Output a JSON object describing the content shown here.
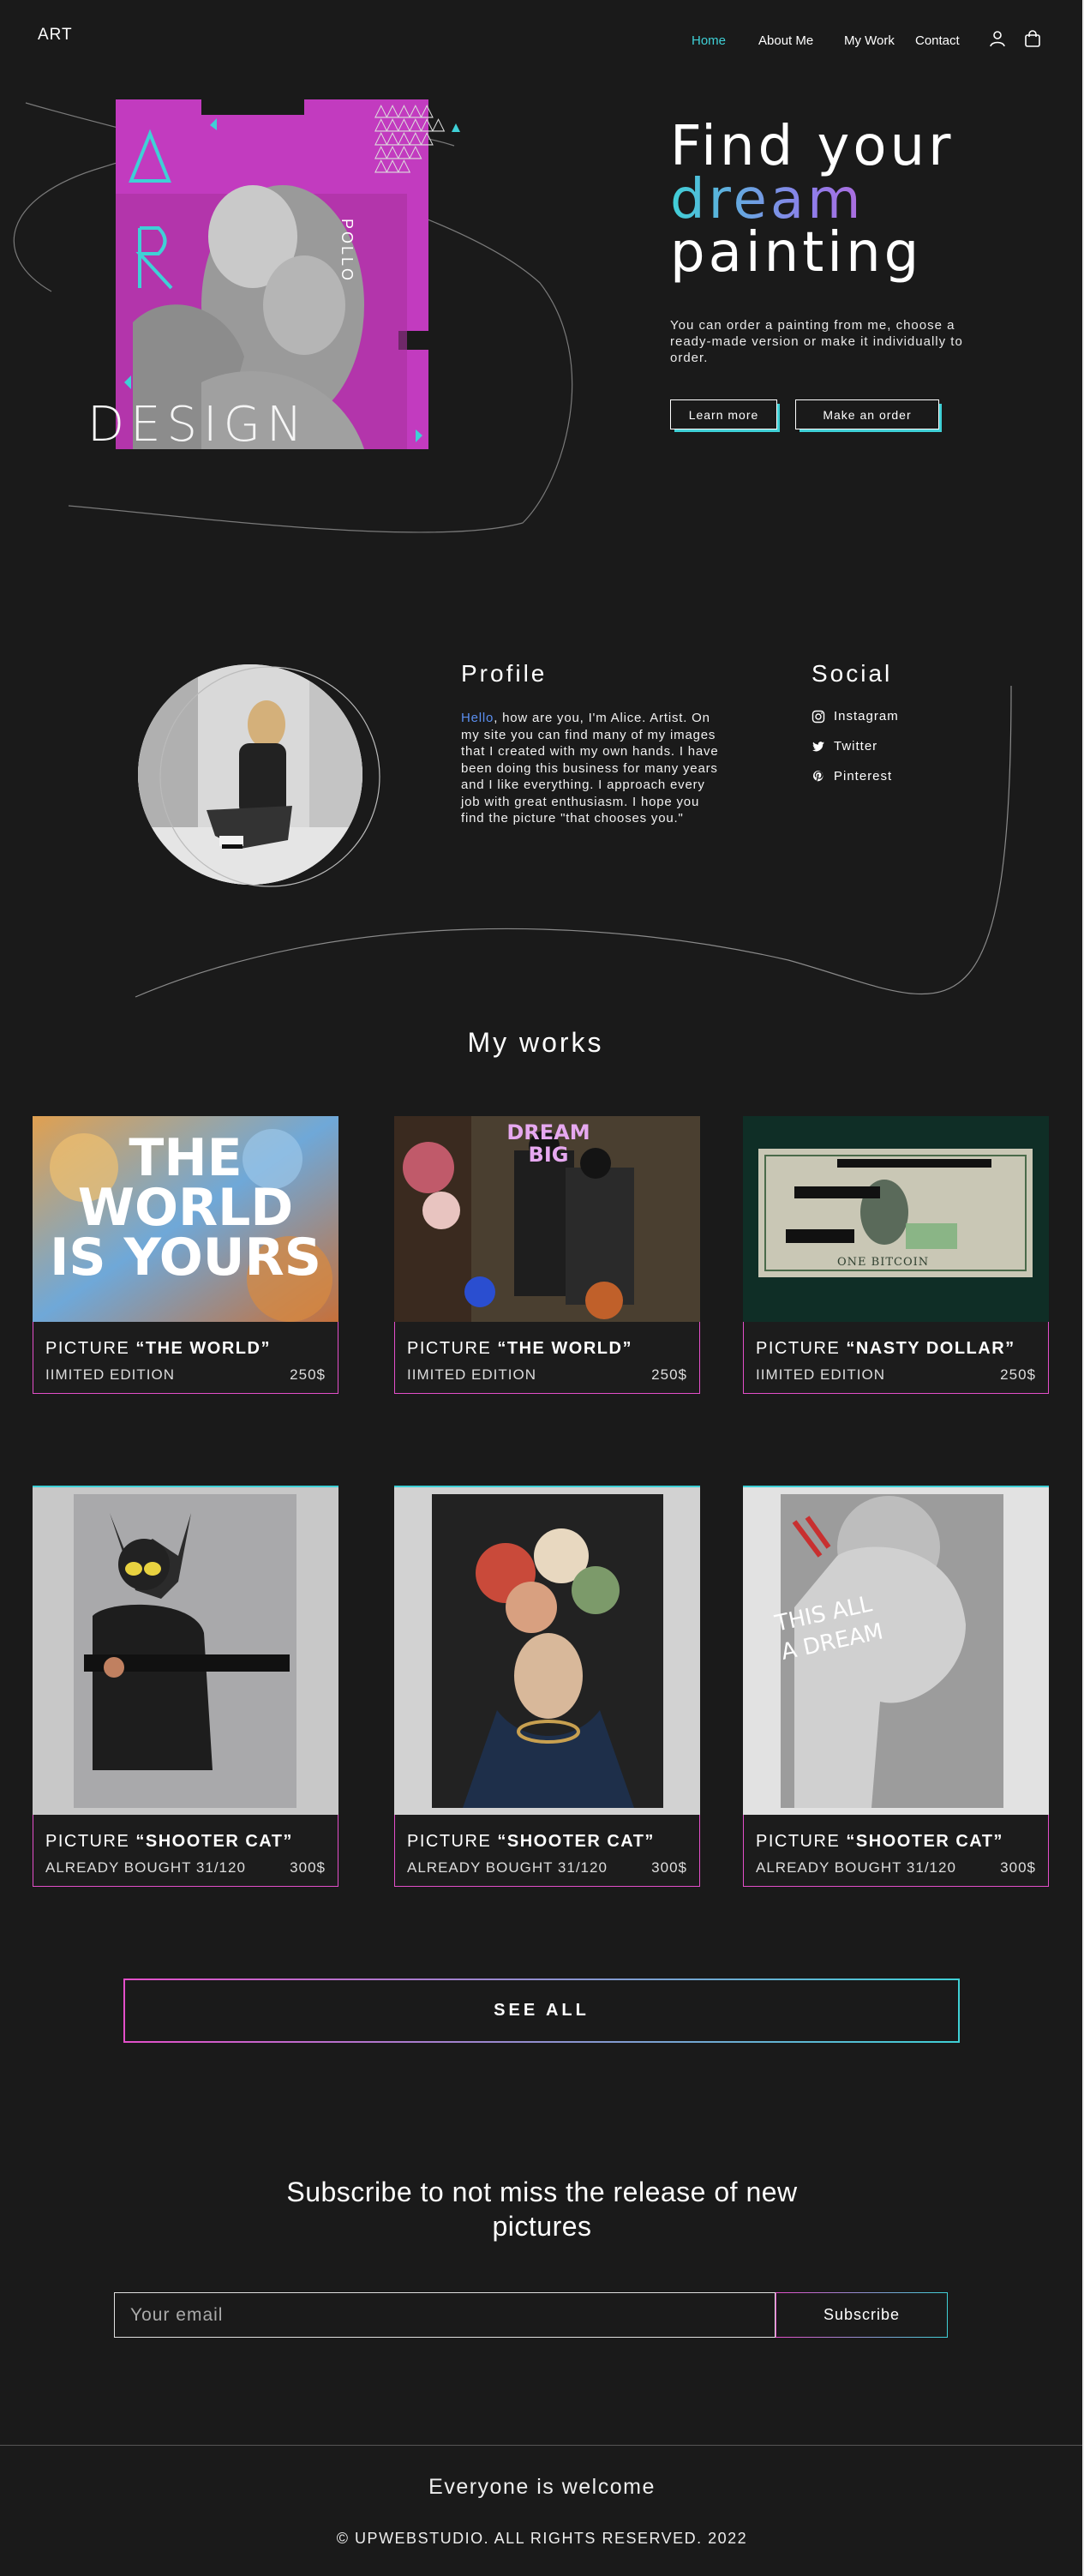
{
  "header": {
    "logo": "ART",
    "nav": [
      "Home",
      "About Me",
      "My Work",
      "Contact"
    ],
    "icons": [
      "user-icon",
      "shopping-bag-icon"
    ]
  },
  "hero": {
    "title_line1": "Find your",
    "title_line2": "dream",
    "title_line3": "painting",
    "description": "You can order a painting from me, choose a ready-made version or make it individually to order.",
    "btn_learn": "Learn more",
    "btn_order": "Make an order",
    "art_label_design": "DESIGN",
    "art_label_pollo": "POLLO"
  },
  "profile": {
    "title": "Profile",
    "hello": "Hello",
    "text": ", how are you, I'm Alice. Artist. On my site you can find many of my images that I created with my own hands. I have been doing this business for many years and I like everything. I approach every job with great enthusiasm. I hope you find the picture \"that chooses you.\""
  },
  "social": {
    "title": "Social",
    "items": [
      "Instagram",
      "Twitter",
      "Pinterest"
    ]
  },
  "works": {
    "title": "My works",
    "cards": [
      {
        "prefix": "PICTURE",
        "name": "“THE WORLD”",
        "sub": "IIMITED EDITION",
        "price": "250$",
        "img_text": "THE WORLD IS YOURS"
      },
      {
        "prefix": "PICTURE",
        "name": "“THE WORLD”",
        "sub": "IIMITED EDITION",
        "price": "250$",
        "img_text": "DREAM BIG"
      },
      {
        "prefix": "PICTURE",
        "name": "“NASTY DOLLAR”",
        "sub": "IIMITED EDITION",
        "price": "250$",
        "img_text": "ONE BITCOIN"
      },
      {
        "prefix": "PICTURE",
        "name": "“SHOOTER CAT”",
        "sub": "ALREADY BOUGHT  31/120",
        "price": "300$"
      },
      {
        "prefix": "PICTURE",
        "name": "“SHOOTER CAT”",
        "sub": "ALREADY BOUGHT  31/120",
        "price": "300$"
      },
      {
        "prefix": "PICTURE",
        "name": "“SHOOTER CAT”",
        "sub": "ALREADY BOUGHT  31/120",
        "price": "300$",
        "img_text": "THIS ALL A DREAM"
      }
    ],
    "see_all": "SEE  ALL"
  },
  "subscribe": {
    "title_line1": "Subscribe to not miss the release of new",
    "title_line2": "pictures",
    "placeholder": "Your email",
    "button": "Subscribe"
  },
  "footer": {
    "welcome": "Everyone is welcome",
    "copyright": "© UPWEBSTUDIO. ALL RIGHTS RESERVED. 2022"
  },
  "colors": {
    "background": "#1a1a1a",
    "accent_cyan": "#3fd0d6",
    "accent_magenta": "#e34fc9",
    "accent_purple": "#8f7dea"
  }
}
